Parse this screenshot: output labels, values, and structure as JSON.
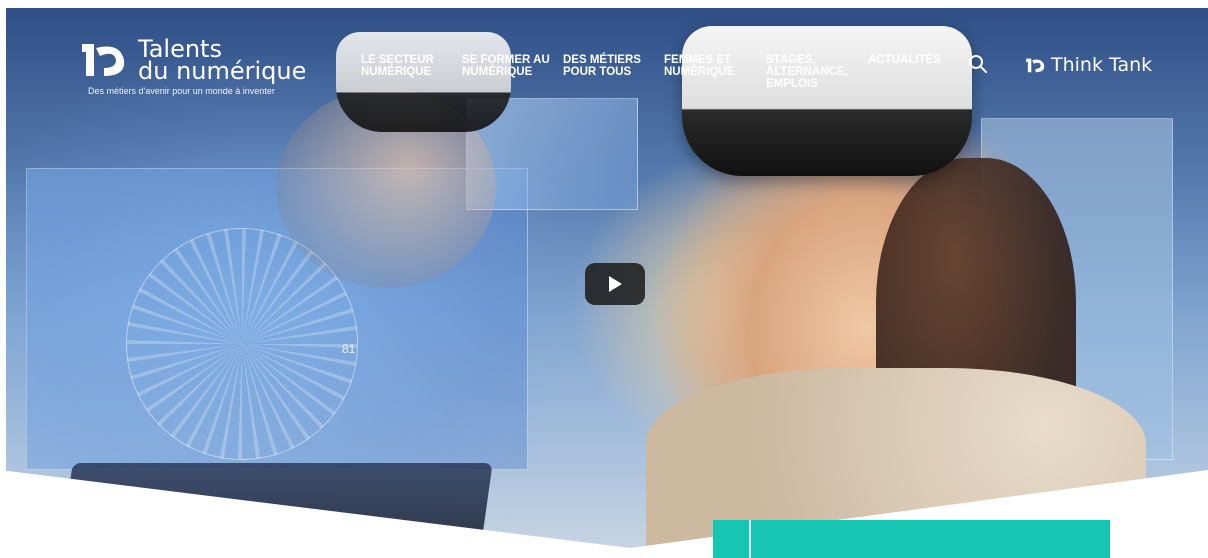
{
  "brand": {
    "logo_line1": "Talents",
    "logo_line2": "du numérique",
    "tagline": "Des métiers d'avenir pour un monde à inventer"
  },
  "nav": {
    "items": [
      {
        "line1": "LE SECTEUR",
        "line2": "NUMÉRIQUE",
        "line3": ""
      },
      {
        "line1": "SE FORMER AU",
        "line2": "NUMÉRIQUE",
        "line3": ""
      },
      {
        "line1": "DES MÉTIERS",
        "line2": "POUR TOUS",
        "line3": ""
      },
      {
        "line1": "FEMMES ET",
        "line2": "NUMÉRIQUE",
        "line3": ""
      },
      {
        "line1": "STAGES,",
        "line2": "ALTERNANCE,",
        "line3": "EMPLOIS"
      },
      {
        "line1": "ACTUALITÉS",
        "line2": "",
        "line3": ""
      }
    ]
  },
  "header_right": {
    "search_icon": "search-icon",
    "think_tank_label": "Think Tank"
  },
  "hero": {
    "video_play_icon": "play-icon",
    "overlay_number": "81"
  },
  "colors": {
    "accent_teal": "#17c6b2",
    "nav_text": "#ffffff"
  }
}
